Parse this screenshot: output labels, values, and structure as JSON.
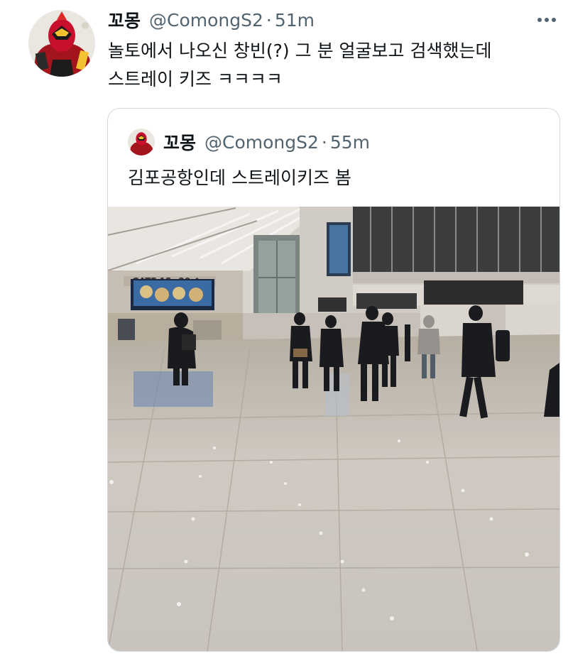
{
  "tweet": {
    "author_name": "꼬몽",
    "handle": "@ComongS2",
    "separator": "·",
    "time": "51m",
    "text_lines": [
      "놀토에서 나오신 창빈(?) 그 분 얼굴보고 검색했는데",
      "스트레이 키즈 ㅋㅋㅋㅋ"
    ],
    "more_icon": "more-horizontal-icon"
  },
  "quoted_tweet": {
    "author_name": "꼬몽",
    "handle": "@ComongS2",
    "separator": "·",
    "time": "55m",
    "text": "김포공항인데 스트레이키즈 봄",
    "media": {
      "kind": "photo",
      "sign_text": "GATE 15~20 ↑"
    }
  },
  "colors": {
    "text_primary": "#0f1419",
    "text_secondary": "#536471",
    "border": "#cfd9de",
    "avatar_red": "#c8102e"
  }
}
